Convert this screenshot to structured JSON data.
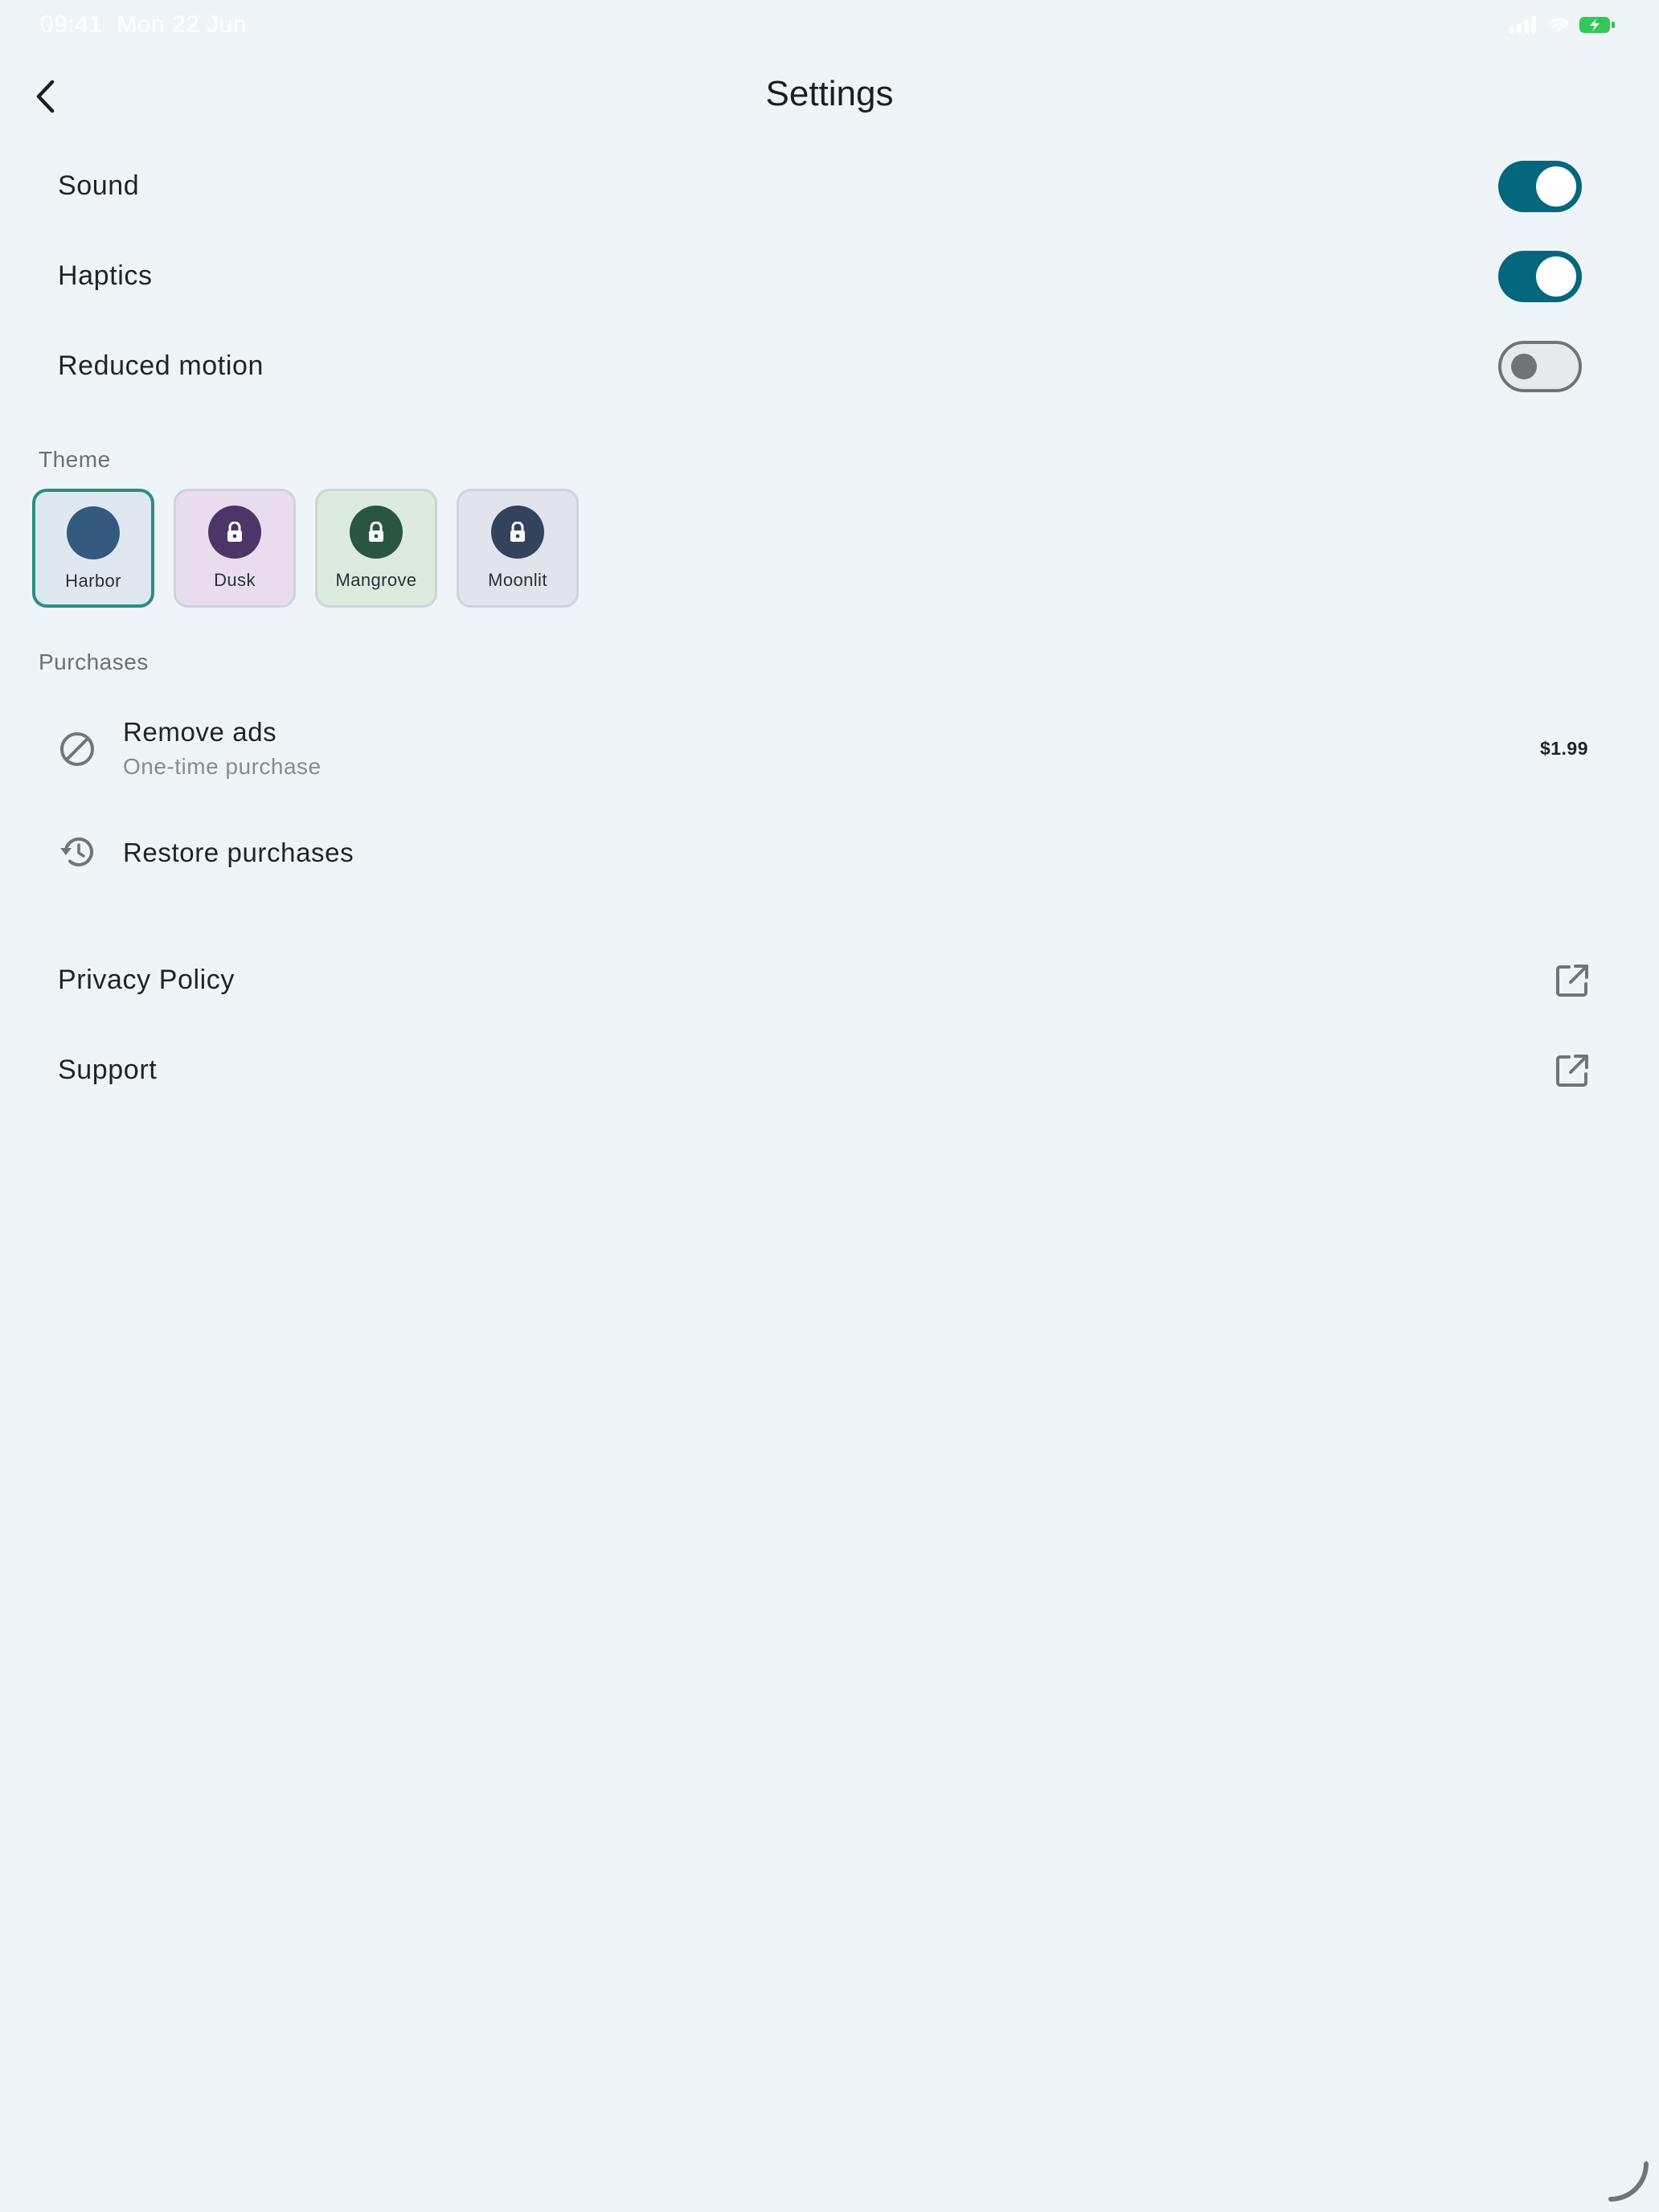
{
  "status_bar": {
    "time": "09:41",
    "date": "Mon 22 Jun",
    "icons": [
      "signal-icon",
      "wifi-icon",
      "battery-charging-icon"
    ]
  },
  "header": {
    "title": "Settings",
    "back_icon": "chevron-left-icon"
  },
  "toggles": [
    {
      "label": "Sound",
      "on": true
    },
    {
      "label": "Haptics",
      "on": true
    },
    {
      "label": "Reduced motion",
      "on": false
    }
  ],
  "theme": {
    "section_label": "Theme",
    "options": [
      {
        "name": "Harbor",
        "selected": true,
        "locked": false,
        "swatch": "#33597f",
        "card_bg": "#dfe8f1"
      },
      {
        "name": "Dusk",
        "selected": false,
        "locked": true,
        "swatch": "#4e3568",
        "card_bg": "#e8dcef"
      },
      {
        "name": "Mangrove",
        "selected": false,
        "locked": true,
        "swatch": "#2a5641",
        "card_bg": "#dcebde"
      },
      {
        "name": "Moonlit",
        "selected": false,
        "locked": true,
        "swatch": "#34435c",
        "card_bg": "#e1e4ec"
      }
    ]
  },
  "purchases": {
    "section_label": "Purchases",
    "remove_ads": {
      "title": "Remove ads",
      "subtitle": "One-time purchase",
      "price": "$1.99",
      "icon": "block-icon"
    },
    "restore": {
      "title": "Restore purchases",
      "icon": "history-icon"
    }
  },
  "links": [
    {
      "label": "Privacy Policy",
      "icon": "external-link-icon"
    },
    {
      "label": "Support",
      "icon": "external-link-icon"
    }
  ],
  "colors": {
    "background": "#eff4f8",
    "accent": "#05677d",
    "selected_border": "#2a8f7e",
    "battery": "#34c759"
  }
}
